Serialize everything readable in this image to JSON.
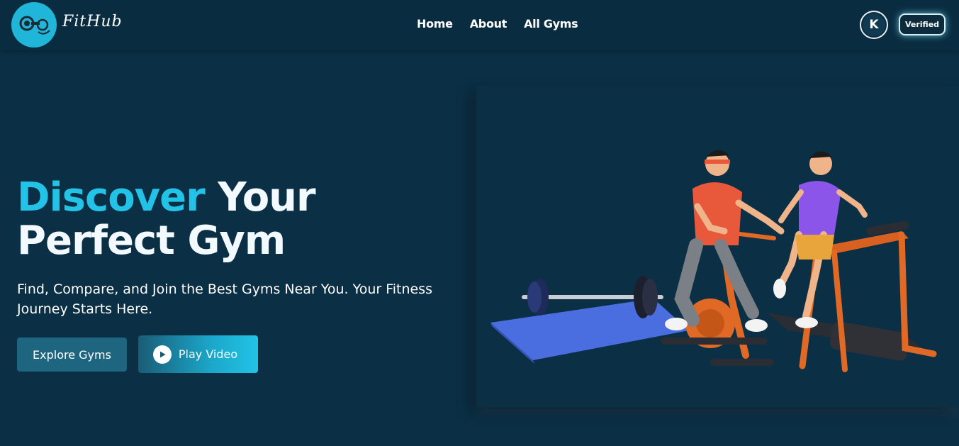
{
  "navbar": {
    "brand": "FitHub",
    "links": [
      "Home",
      "About",
      "All Gyms"
    ],
    "avatar_initial": "K",
    "verified_label": "Verified"
  },
  "hero": {
    "headline_accent": "Discover",
    "headline_rest_line1": "Your",
    "headline_line2": "Perfect Gym",
    "subtitle": "Find, Compare, and Join the Best Gyms Near You. Your Fitness Journey Starts Here.",
    "explore_button": "Explore Gyms",
    "video_button": "Play Video"
  },
  "colors": {
    "background": "#0b2f45",
    "accent": "#22c3e6",
    "button_dark": "#1e6680"
  },
  "icons": {
    "logo": "dumbbell-logo-icon",
    "play": "play-icon",
    "illustration": "gym-equipment-illustration"
  }
}
